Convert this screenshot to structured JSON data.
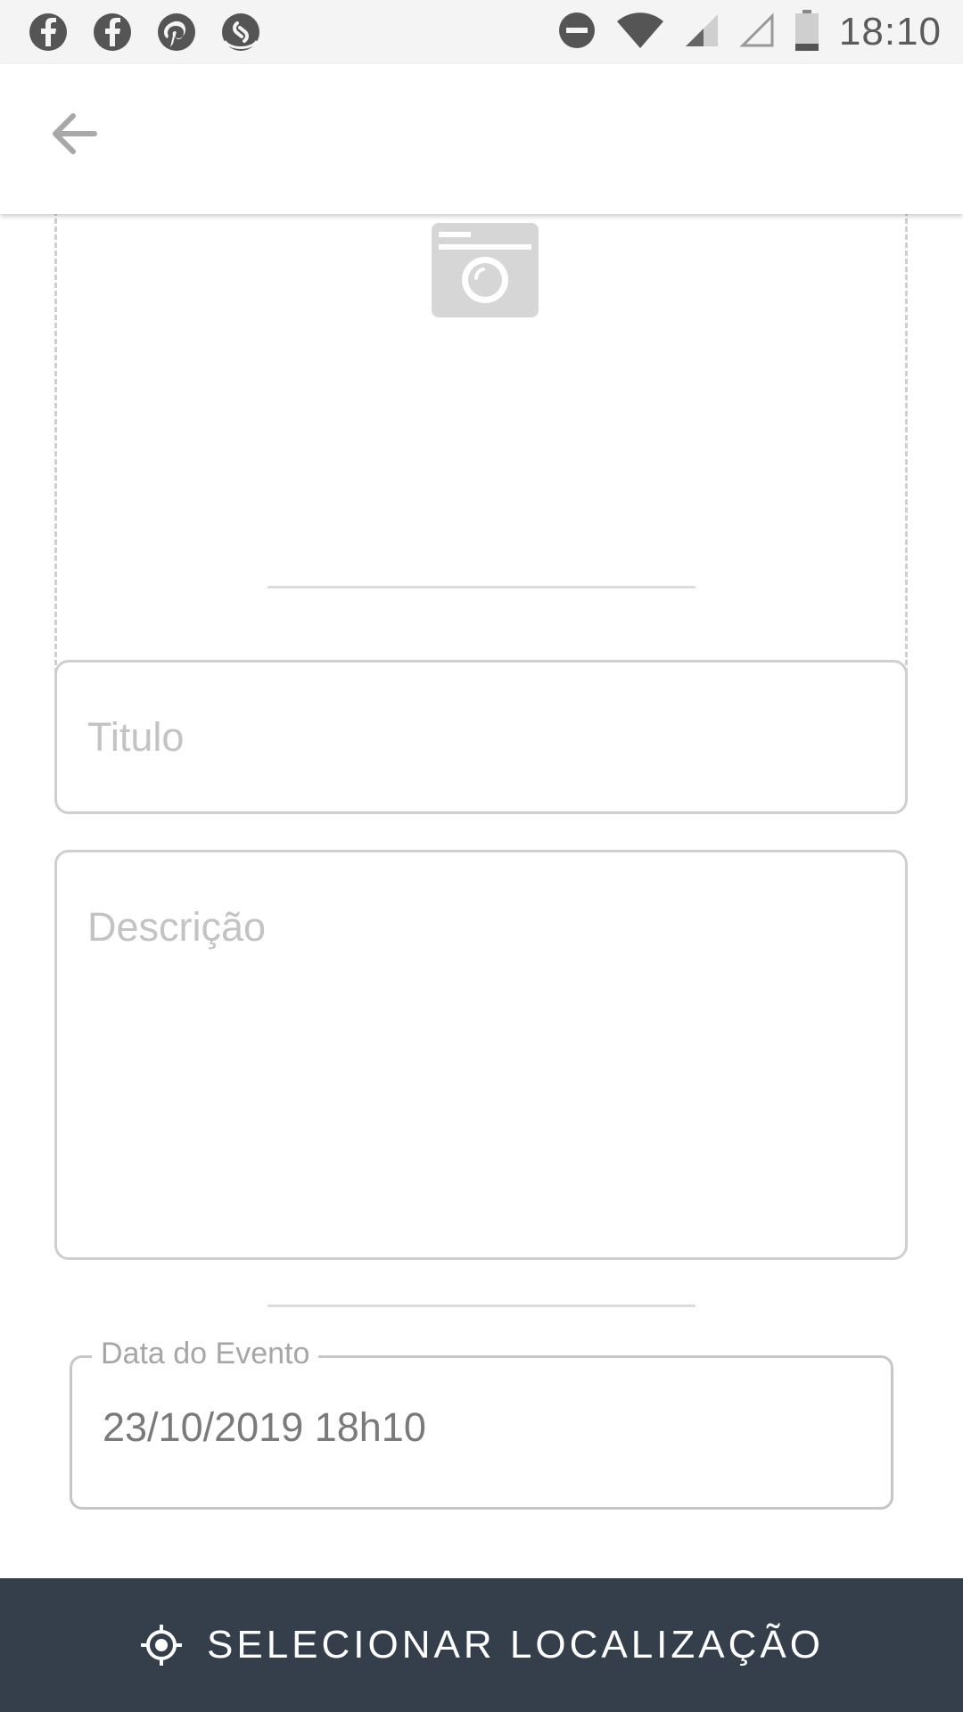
{
  "status_bar": {
    "time": "18:10",
    "notification_icons": [
      "facebook-icon",
      "facebook-icon",
      "pinterest-icon",
      "shazam-icon"
    ],
    "system_icons": [
      "do-not-disturb-icon",
      "wifi-icon",
      "signal-icon",
      "signal-empty-icon",
      "battery-icon"
    ]
  },
  "app_bar": {
    "back_icon": "arrow-left-icon"
  },
  "photo_picker": {
    "icon": "camera-icon"
  },
  "form": {
    "title_placeholder": "Titulo",
    "description_placeholder": "Descrição",
    "date_label": "Data do Evento",
    "date_value": "23/10/2019 18h10"
  },
  "bottom_action": {
    "icon": "gps-target-icon",
    "label": "SELECIONAR LOCALIZAÇÃO"
  },
  "colors": {
    "bottom_bar_bg": "#353e4b",
    "status_bar_bg": "#f4f4f4",
    "border": "#cfcfcf",
    "placeholder": "#c3c3c3"
  }
}
